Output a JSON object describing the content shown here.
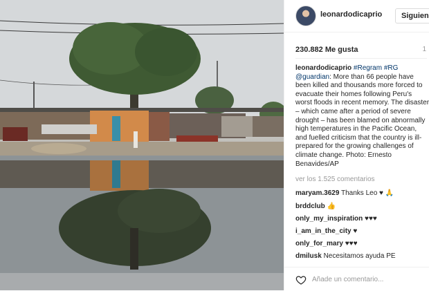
{
  "post": {
    "username": "leonardodicaprio",
    "follow_label": "Siguiendo",
    "likes": "230.882 Me gusta",
    "time": "1",
    "caption_user": "leonardodicaprio",
    "caption_tags": "#Regram #RG",
    "caption_mention": "@guardian",
    "caption_text": ": More than 66 people have been killed and thousands more forced to evacuate their homes following Peru's worst floods in recent memory. The disaster – which came after a period of severe drought – has been blamed on abnormally high temperatures in the Pacific Ocean, and fuelled criticism that the country is ill-prepared for the growing challenges of climate change. Photo: Ernesto Benavides/AP",
    "view_comments": "ver los 1.525 comentarios"
  },
  "comments": [
    {
      "user": "maryam.3629",
      "text": "Thanks Leo",
      "emoji": "♥ 🙏"
    },
    {
      "user": "brddclub",
      "text": "",
      "emoji": "👍"
    },
    {
      "user": "only_my_inspiration",
      "text": "",
      "emoji": "♥♥♥"
    },
    {
      "user": "i_am_in_the_city",
      "text": "",
      "emoji": "♥"
    },
    {
      "user": "only_for_mary",
      "text": "",
      "emoji": "♥♥♥"
    },
    {
      "user": "dmilusk",
      "text": "Necesitamos ayuda",
      "emoji": "PE"
    }
  ],
  "comment_box": {
    "placeholder": "Añade un comentario..."
  },
  "colors": {
    "link": "#003569",
    "muted": "#999999",
    "text": "#262626",
    "border": "#efefef"
  }
}
